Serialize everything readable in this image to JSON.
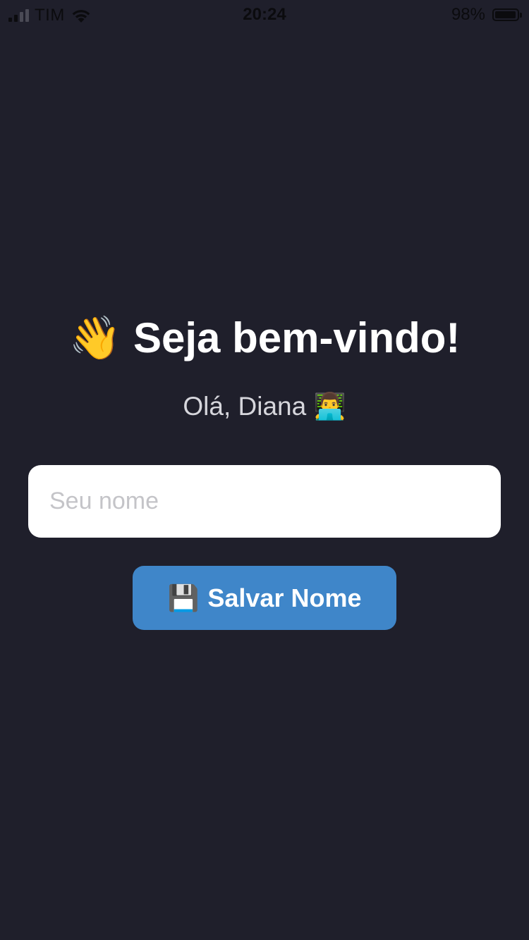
{
  "status_bar": {
    "carrier": "TIM",
    "time": "20:24",
    "battery_percent": "98%",
    "battery_level": 0.98,
    "signal_bars": 2,
    "signal_total": 4
  },
  "welcome": {
    "wave_icon": "👋",
    "title": "Seja bem-vindo!",
    "greeting": "Olá, Diana",
    "avatar_icon": "👨‍💻"
  },
  "form": {
    "name_placeholder": "Seu nome",
    "name_value": "",
    "save_icon": "💾",
    "save_label": "Salvar Nome"
  },
  "colors": {
    "background": "#1f1f2b",
    "button": "#3f86c9",
    "input_background": "#ffffff"
  }
}
